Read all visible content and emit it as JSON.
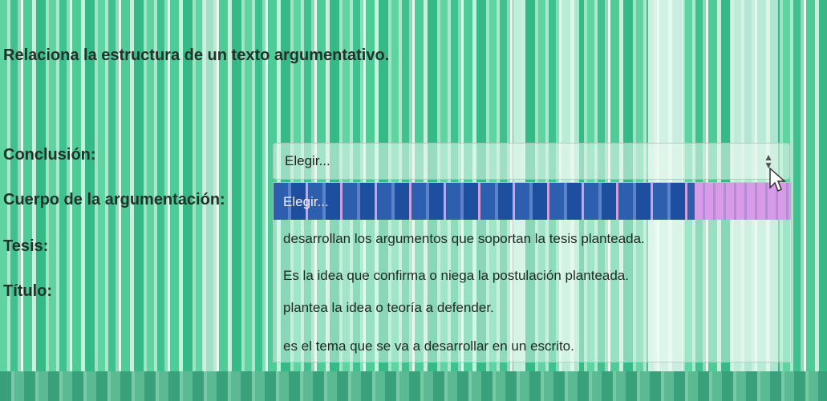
{
  "question": {
    "title": "Relaciona la estructura de un texto argumentativo."
  },
  "rows": [
    {
      "label": "Conclusión:"
    },
    {
      "label": "Cuerpo de la argumentación:"
    },
    {
      "label": "Tesis:"
    },
    {
      "label": "Título:"
    }
  ],
  "select": {
    "value": "Elegir...",
    "arrow_icon": "up-down-arrows-icon"
  },
  "dropdown": {
    "options": [
      "Elegir...",
      "desarrollan los argumentos que soportan la tesis planteada.",
      "Es la idea que confirma o niega la postulación planteada.",
      "plantea la idea o teoría a defender.",
      "es el tema que se va a desarrollar en un escrito."
    ],
    "selected_index": 0
  },
  "colors": {
    "highlight": "#2d5fae",
    "background_stripes": "#5fd3a2",
    "text": "#23312b"
  }
}
